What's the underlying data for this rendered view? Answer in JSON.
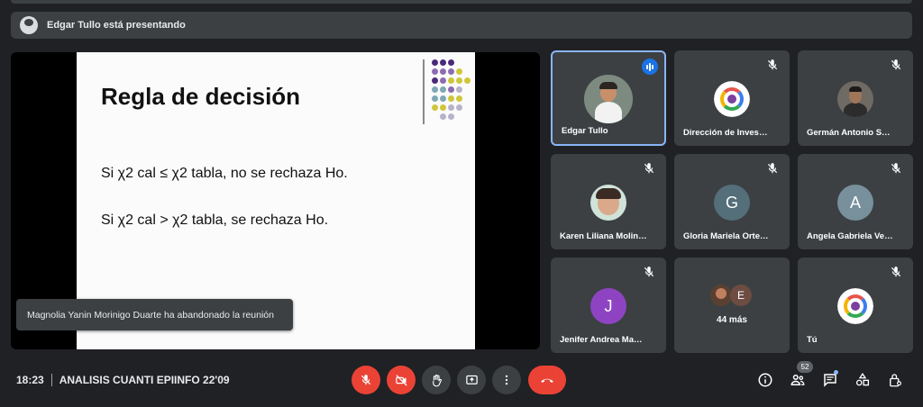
{
  "presenter": {
    "text": "Edgar Tullo está presentando"
  },
  "slide": {
    "title": "Regla de decisión",
    "line1": "Si χ2 cal ≤ χ2 tabla,  no se rechaza Ho.",
    "line2": "Si χ2 cal > χ2 tabla,  se rechaza Ho."
  },
  "toast": "Magnolia Yanin Morinigo Duarte ha abandonado la reunión",
  "participants": [
    {
      "name": "Edgar Tullo",
      "speaking": true
    },
    {
      "name": "Dirección de Inves…",
      "muted": true
    },
    {
      "name": "Germán Antonio S…",
      "muted": true
    },
    {
      "name": "Karen Liliana Molin…",
      "muted": true
    },
    {
      "name": "Gloria Mariela Orte…",
      "muted": true,
      "initial": "G"
    },
    {
      "name": "Angela Gabriela Ve…",
      "muted": true,
      "initial": "A"
    },
    {
      "name": "Jenifer Andrea Ma…",
      "muted": true,
      "initial": "J"
    },
    {
      "name": "44 más",
      "initial": "E"
    },
    {
      "name": "Tú",
      "muted": true
    }
  ],
  "meeting": {
    "time": "18:23",
    "name": "ANALISIS CUANTI EPIINFO 22'09"
  },
  "people_count": "52",
  "colors": {
    "accent": "#8ab4f8",
    "danger": "#ea4335",
    "surface": "#3c4043",
    "background": "#202124"
  }
}
